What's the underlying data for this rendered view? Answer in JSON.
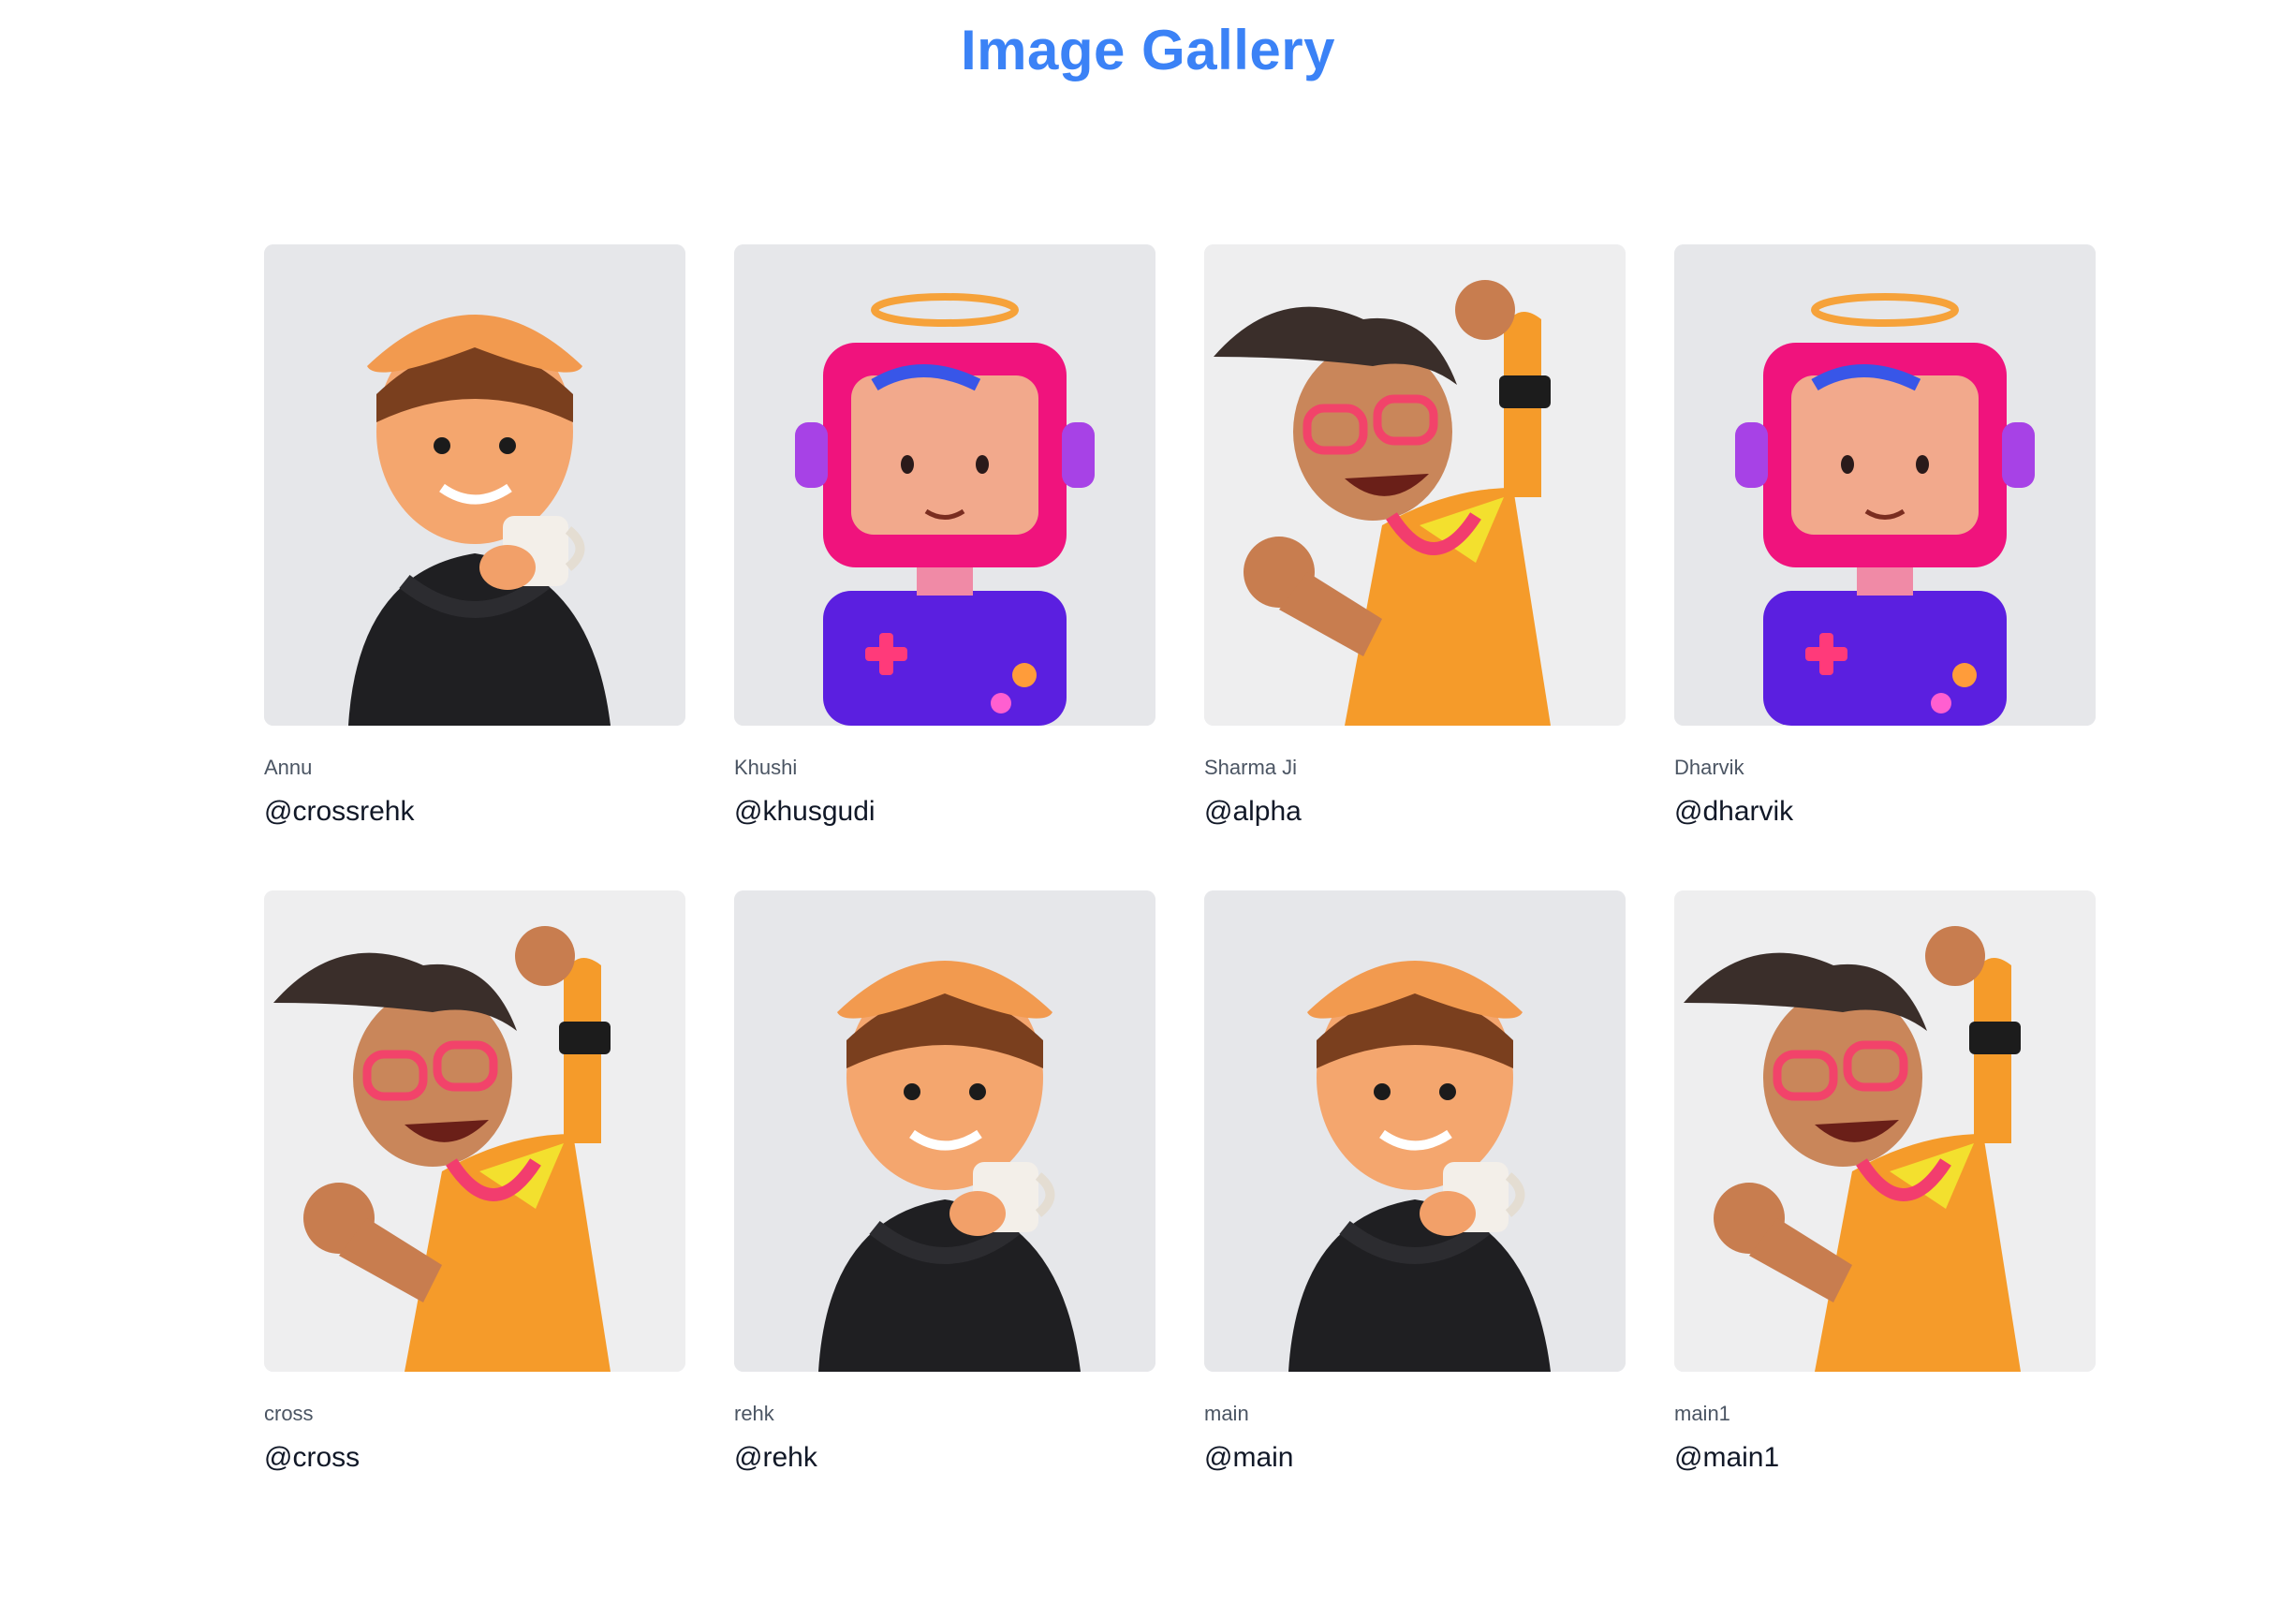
{
  "page": {
    "title": "Image Gallery",
    "accent": "#3b82f6"
  },
  "gallery": {
    "items": [
      {
        "name": "Annu",
        "handle": "@crossrehk",
        "avatar": "coffee-boy-avatar"
      },
      {
        "name": "Khushi",
        "handle": "@khusgudi",
        "avatar": "robot-avatar"
      },
      {
        "name": "Sharma Ji",
        "handle": "@alpha",
        "avatar": "cheering-boy-avatar"
      },
      {
        "name": "Dharvik",
        "handle": "@dharvik",
        "avatar": "robot-avatar"
      },
      {
        "name": "cross",
        "handle": "@cross",
        "avatar": "cheering-boy-avatar"
      },
      {
        "name": "rehk",
        "handle": "@rehk",
        "avatar": "coffee-boy-avatar"
      },
      {
        "name": "main",
        "handle": "@main",
        "avatar": "coffee-boy-avatar"
      },
      {
        "name": "main1",
        "handle": "@main1",
        "avatar": "cheering-boy-avatar"
      }
    ]
  }
}
